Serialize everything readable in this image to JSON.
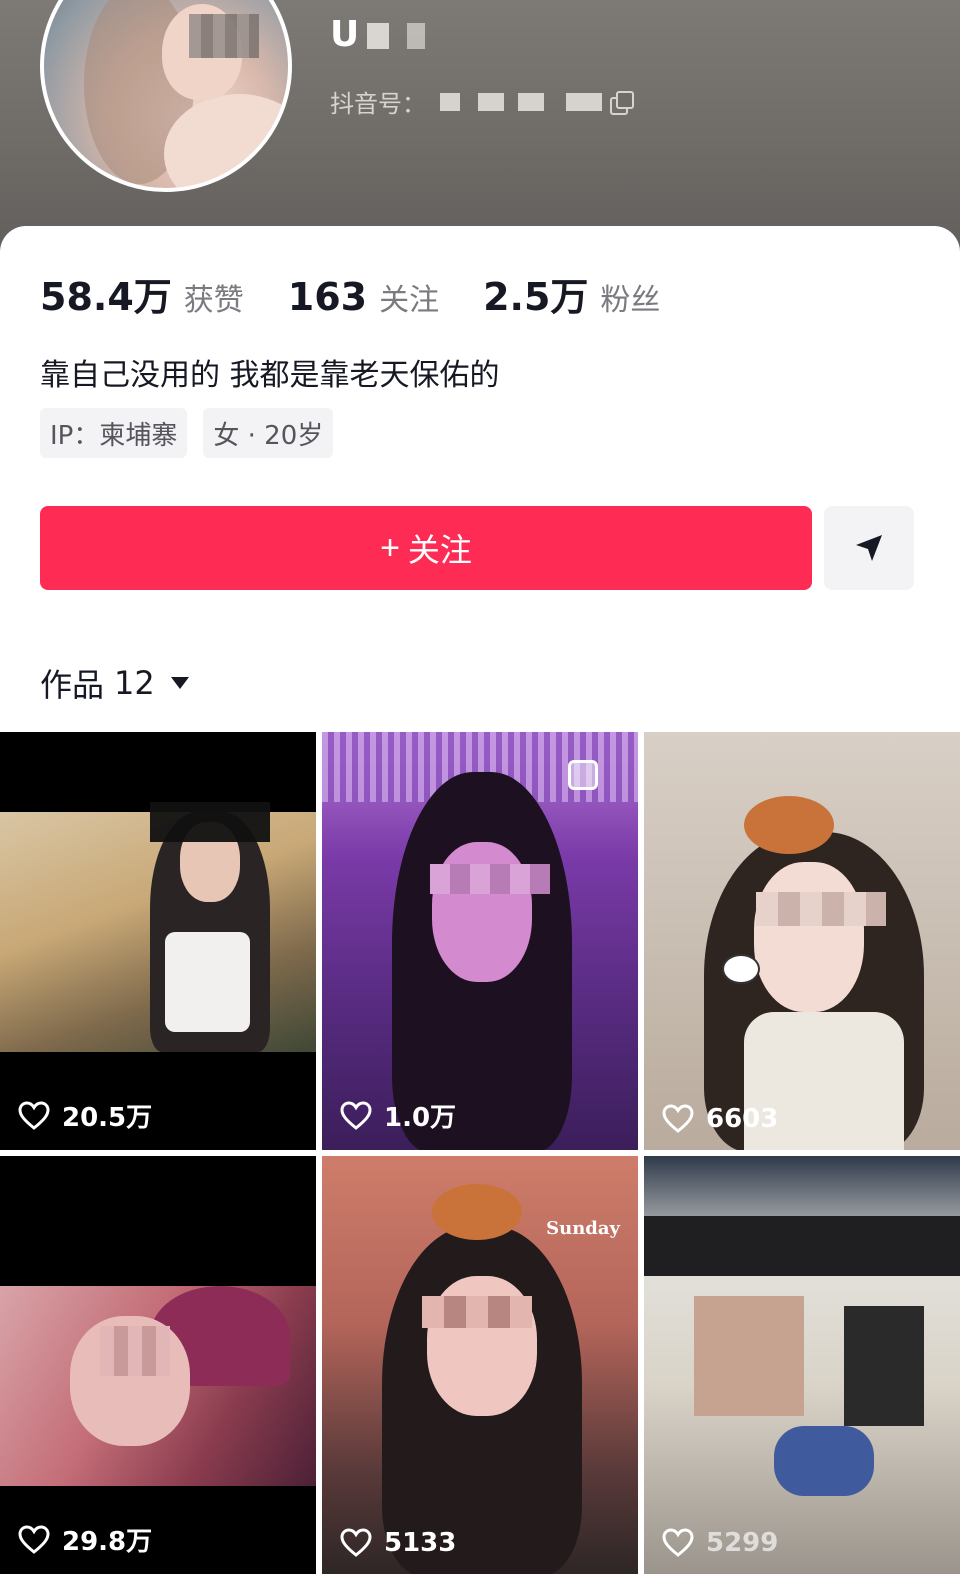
{
  "profile": {
    "username": "U",
    "douyin_id_label": "抖音号：",
    "stats": [
      {
        "value": "58.4万",
        "label": "获赞"
      },
      {
        "value": "163",
        "label": "关注"
      },
      {
        "value": "2.5万",
        "label": "粉丝"
      }
    ],
    "bio": "靠自己没用的 我都是靠老天保佑的",
    "tags": [
      "IP：柬埔寨",
      "女 · 20岁"
    ]
  },
  "actions": {
    "follow_plus": "+",
    "follow_label": "关注",
    "share_icon": "send-icon"
  },
  "works": {
    "label": "作品",
    "count": "12"
  },
  "videos": [
    {
      "likes": "20.5万"
    },
    {
      "likes": "1.0万"
    },
    {
      "likes": "6603"
    },
    {
      "likes": "29.8万"
    },
    {
      "likes": "5133"
    },
    {
      "likes": "5299"
    }
  ],
  "thumb_texts": {
    "sunday": "Sunday"
  },
  "colors": {
    "accent": "#fe2c55",
    "text": "#161823",
    "secondary": "#7a7a80"
  }
}
